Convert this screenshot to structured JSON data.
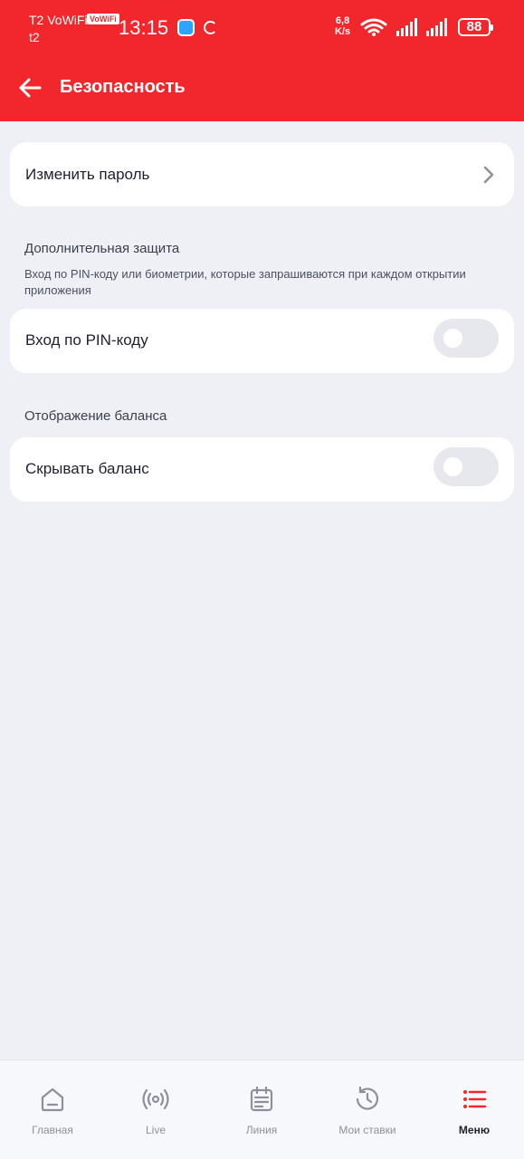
{
  "status_bar": {
    "carrier_line1": "T2 VoWiFi",
    "vowifi_badge": "VoWiFi",
    "carrier_line2": "t2",
    "time": "13:15",
    "net_speed_value": "6,8",
    "net_speed_unit": "K/s",
    "battery": "88",
    "icons": [
      "message-icon",
      "sync-icon",
      "wifi-icon",
      "signal-icon",
      "signal-icon",
      "battery-icon"
    ]
  },
  "app_bar": {
    "title": "Безопасность",
    "back_icon": "arrow-left-icon"
  },
  "content": {
    "change_password": {
      "label": "Изменить пароль",
      "icon": "chevron-right-icon"
    },
    "extra_protection": {
      "title": "Дополнительная защита",
      "description": "Вход по PIN-коду или биометрии, которые запрашиваются при каждом открытии приложения",
      "pin_login": {
        "label": "Вход по PIN-коду",
        "enabled": false
      }
    },
    "balance_display": {
      "title": "Отображение баланса",
      "hide_balance": {
        "label": "Скрывать баланс",
        "enabled": false
      }
    }
  },
  "bottom_nav": {
    "items": [
      {
        "label": "Главная",
        "icon": "home-icon",
        "active": false
      },
      {
        "label": "Live",
        "icon": "broadcast-icon",
        "active": false
      },
      {
        "label": "Линия",
        "icon": "calendar-icon",
        "active": false
      },
      {
        "label": "Мои ставки",
        "icon": "history-icon",
        "active": false
      },
      {
        "label": "Меню",
        "icon": "menu-list-icon",
        "active": true
      }
    ]
  },
  "colors": {
    "brand_red": "#f2272c",
    "background": "#eef0f6",
    "toggle_off": "#e6e8ee",
    "text_primary": "#1d2130",
    "nav_inactive": "#8c909c"
  }
}
